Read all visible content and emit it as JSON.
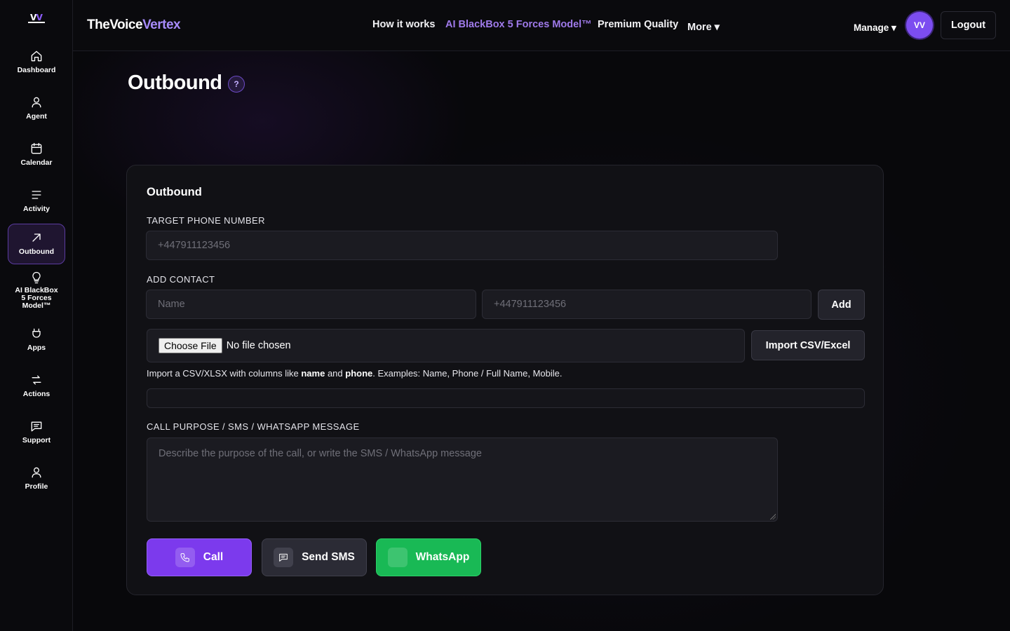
{
  "sidebar": {
    "logo": {
      "part1": "v",
      "part2": "v"
    },
    "items": [
      {
        "label": "Dashboard",
        "icon": "home-icon"
      },
      {
        "label": "Agent",
        "icon": "user-icon"
      },
      {
        "label": "Calendar",
        "icon": "calendar-icon"
      },
      {
        "label": "Activity",
        "icon": "list-icon"
      },
      {
        "label": "Outbound",
        "icon": "arrow-up-right-icon",
        "active": true
      },
      {
        "label": "AI BlackBox 5 Forces Model™",
        "icon": "lightbulb-icon"
      },
      {
        "label": "Apps",
        "icon": "plug-icon"
      },
      {
        "label": "Actions",
        "icon": "transfer-icon"
      },
      {
        "label": "Support",
        "icon": "message-icon"
      },
      {
        "label": "Profile",
        "icon": "user-icon"
      }
    ]
  },
  "header": {
    "brand_part1": "TheVoice",
    "brand_part2": "Vertex",
    "nav": {
      "how": "How it works",
      "blackbox": "AI BlackBox 5 Forces Model™",
      "premium": "Premium Quality",
      "more": "More ▾"
    },
    "manage": "Manage ▾",
    "avatar": "VV",
    "logout": "Logout"
  },
  "page": {
    "title": "Outbound",
    "help": "?"
  },
  "card": {
    "title": "Outbound",
    "target_label": "TARGET PHONE NUMBER",
    "target_placeholder": "+447911123456",
    "add_contact_label": "ADD CONTACT",
    "name_placeholder": "Name",
    "phone_placeholder": "+447911123456",
    "add_button": "Add",
    "choose_file": "Choose File",
    "no_file": "No file chosen",
    "import_button": "Import CSV/Excel",
    "hint": {
      "prefix": "Import a CSV/XLSX with columns like ",
      "name": "name",
      "and": " and ",
      "phone": "phone",
      "suffix": ". Examples: Name, Phone / Full Name, Mobile."
    },
    "purpose_label": "CALL PURPOSE / SMS / WHATSAPP MESSAGE",
    "purpose_placeholder": "Describe the purpose of the call, or write the SMS / WhatsApp message",
    "call_button": "Call",
    "sms_button": "Send SMS",
    "whatsapp_button": "WhatsApp"
  },
  "colors": {
    "accent": "#7c3aed",
    "accent_text": "#9f7aea",
    "whatsapp": "#19b955",
    "background": "#08080b"
  }
}
